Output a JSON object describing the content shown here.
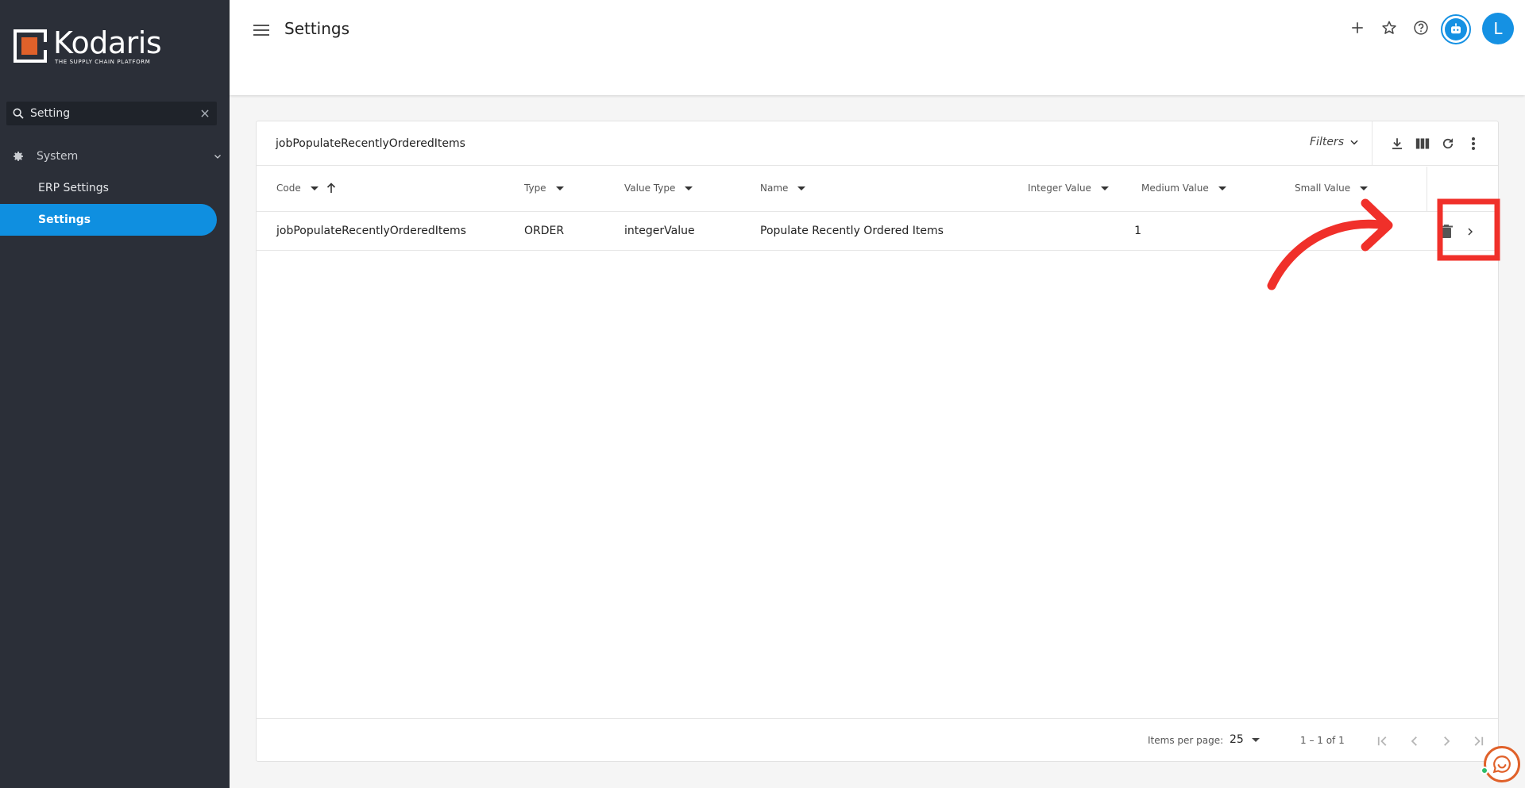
{
  "sidebar": {
    "logo_name": "Kodaris",
    "logo_tagline": "THE SUPPLY CHAIN PLATFORM",
    "search_value": "Setting",
    "group_label": "System",
    "items": [
      {
        "label": "ERP Settings"
      },
      {
        "label": "Settings"
      }
    ]
  },
  "header": {
    "title": "Settings",
    "avatar_initial": "L"
  },
  "card": {
    "title": "jobPopulateRecentlyOrderedItems",
    "filters_label": "Filters"
  },
  "table": {
    "columns": [
      "Code",
      "Type",
      "Value Type",
      "Name",
      "Integer Value",
      "Medium Value",
      "Small Value"
    ],
    "rows": [
      {
        "code": "jobPopulateRecentlyOrderedItems",
        "type": "ORDER",
        "value_type": "integerValue",
        "name": "Populate Recently Ordered Items",
        "integer_value": "1",
        "medium_value": "",
        "small_value": ""
      }
    ]
  },
  "pagination": {
    "items_per_page_label": "Items per page:",
    "items_per_page": "25",
    "range_label": "1 – 1 of 1"
  },
  "colors": {
    "sidebar_bg": "#2b2f38",
    "accent": "#0f8fe0",
    "annotation": "#f0302a",
    "brand_orange": "#e0612a"
  }
}
